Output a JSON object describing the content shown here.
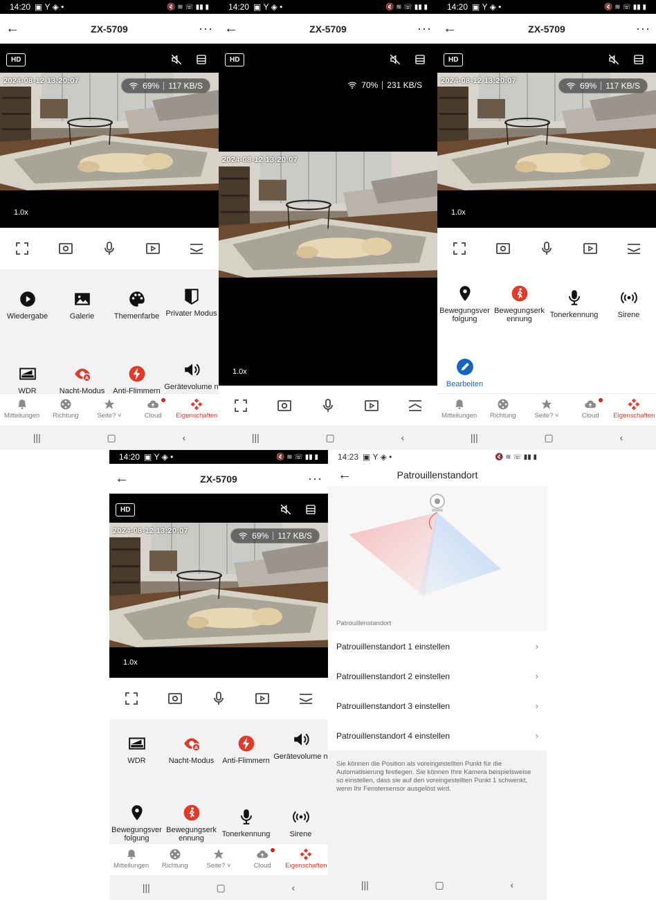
{
  "status": {
    "time": "14:20",
    "time_patrol": "14:23",
    "left_icons": "▣ Y ◈ •",
    "right_icons": "🔇 ≋ ☏ ▮▮ ▮"
  },
  "camera": {
    "title": "ZX-5709",
    "hd_label": "HD",
    "timestamp": "2024-08-12 13:20:07",
    "wifi_a": "69%",
    "speed_a": "117 KB/S",
    "wifi_b": "70%",
    "speed_b": "231 KB/S",
    "zoom": "1.0x"
  },
  "features": {
    "wiedergabe": "Wiedergabe",
    "galerie": "Galerie",
    "themenfarbe": "Themenfarbe",
    "privater": "Privater Modus",
    "wdr": "WDR",
    "nacht": "Nacht-Modus",
    "flimmern": "Anti-Flimmern",
    "lautstaerke": "Gerätevolume n",
    "bewegungsverfolgung": "Bewegungsver folgung",
    "bewegungserkennung": "Bewegungserk ennung",
    "tonerkennung": "Tonerkennung",
    "sirene": "Sirene",
    "bearbeiten": "Bearbeiten"
  },
  "tabs": {
    "mitteilungen": "Mitteilungen",
    "richtung": "Richtung",
    "seite": "Seite? ˅",
    "cloud": "Cloud",
    "eigenschaften": "Eigenschaften"
  },
  "nav": {
    "recents": "|||",
    "home": "▢",
    "back": "‹"
  },
  "patrol": {
    "title": "Patrouillenstandort",
    "caption": "Patrouillenstandort",
    "rows": [
      "Patrouillenstandort 1 einstellen",
      "Patrouillenstandort 2 einstellen",
      "Patrouillenstandort 3 einstellen",
      "Patrouillenstandort 4 einstellen"
    ],
    "note": "Sie können die Position als voreingestellten Punkt für die Automatisierung festlegen. Sie können Ihre Kamera beispielsweise so einstellen, dass sie auf den voreingestellten Punkt 1 schwenkt, wenn Ihr Fenstersensor ausgelöst wird."
  },
  "colors": {
    "accent": "#e03a2a",
    "blue": "#1565c0"
  }
}
